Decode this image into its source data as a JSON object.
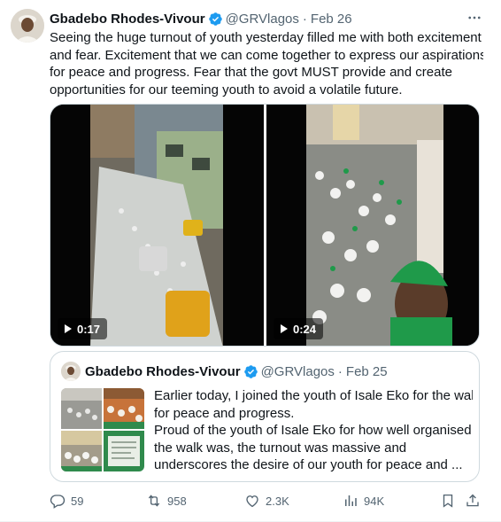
{
  "tweet": {
    "author_name": "Gbadebo Rhodes-Vivour",
    "handle": "@GRVlagos",
    "separator": "·",
    "date": "Feb 26",
    "text_lines": [
      "Seeing the huge turnout of youth yesterday filled me with both excitement",
      "and fear. Excitement that we can come together to express our aspirations",
      "for peace and progress. Fear that the govt MUST provide and create",
      "opportunities for our teeming youth to avoid a volatile future."
    ],
    "videos": [
      {
        "duration": "0:17",
        "icon": "play-icon"
      },
      {
        "duration": "0:24",
        "icon": "play-icon"
      }
    ]
  },
  "quote": {
    "author_name": "Gbadebo Rhodes-Vivour",
    "handle": "@GRVlagos",
    "separator": "·",
    "date": "Feb 25",
    "text_lines": [
      "Earlier today, I joined the youth of Isale Eko for the walk",
      "for peace and progress.",
      "Proud of the youth of Isale Eko for how well organised",
      "the walk was, the turnout was massive and",
      "underscores the desire of our youth for peace and ..."
    ]
  },
  "actions": {
    "replies": "59",
    "reposts": "958",
    "likes": "2.3K",
    "views": "94K"
  },
  "icons": [
    "verified-badge-icon",
    "more-icon",
    "reply-icon",
    "repost-icon",
    "like-icon",
    "views-icon",
    "bookmark-icon",
    "share-icon"
  ],
  "colors": {
    "verified": "#1d9bf0",
    "secondary_text": "#536471",
    "border": "#cfd9de"
  }
}
